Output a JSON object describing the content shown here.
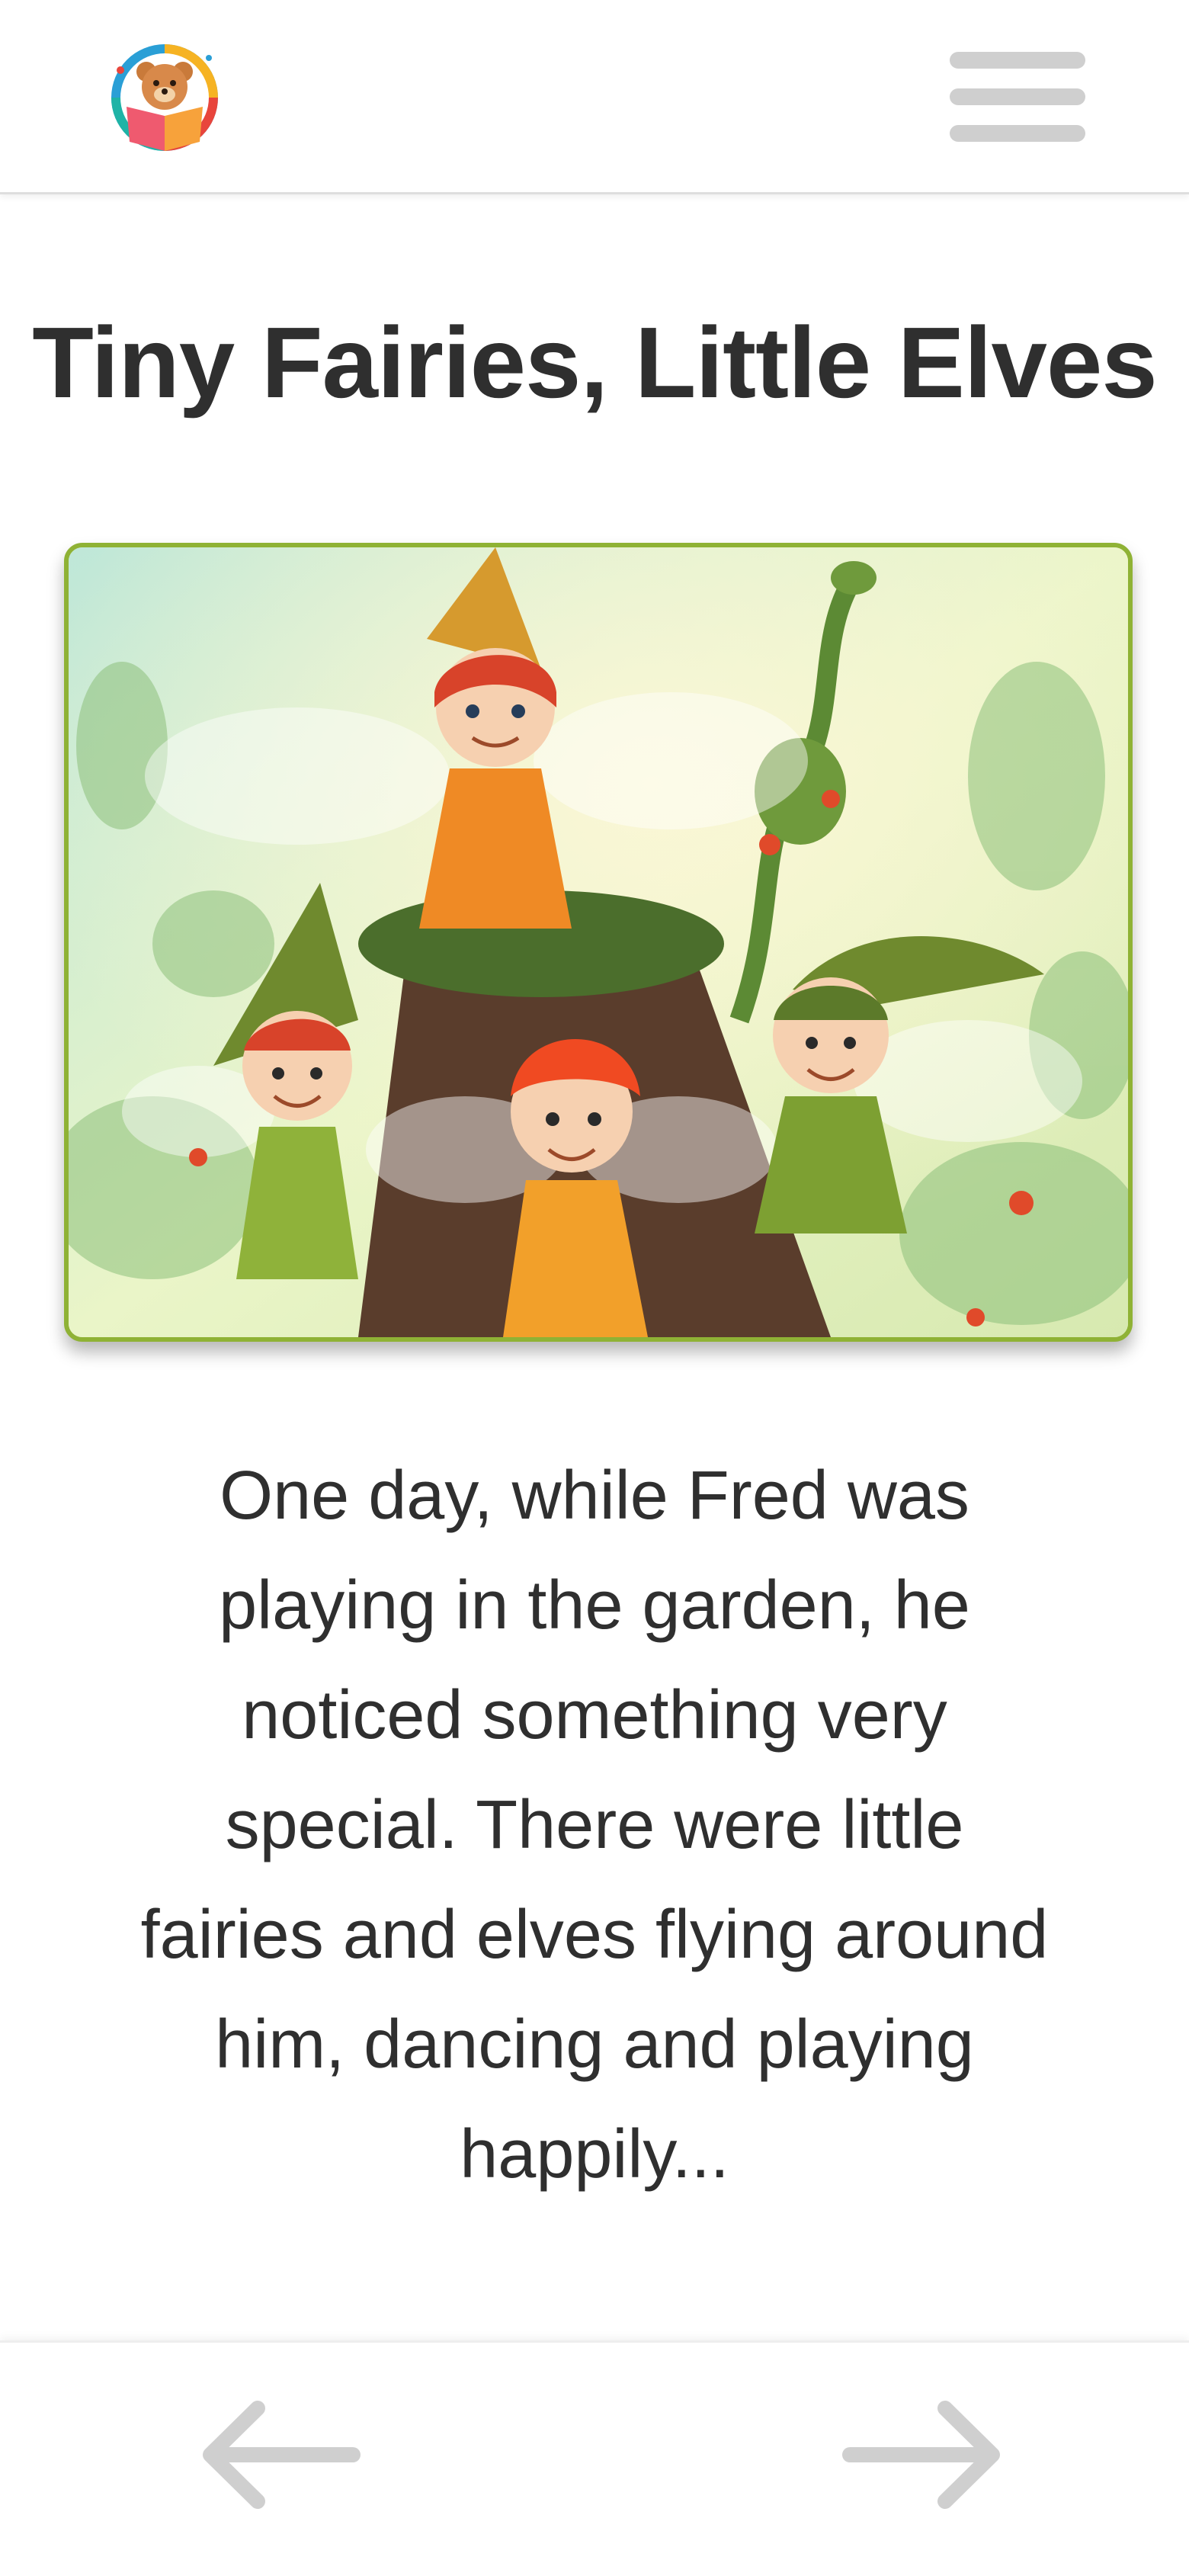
{
  "header": {
    "logo_icon": "teddy-bear-reading-book-icon",
    "menu_icon": "hamburger-menu-icon"
  },
  "page": {
    "title": "Tiny Fairies, Little Elves",
    "story_text": "One day, while Fred was playing in the garden, he noticed something very special. There were little fairies and elves flying around him, dancing and playing happily..."
  },
  "illustration": {
    "subject": "fairies-and-elves-on-tree-stump-illustration",
    "border_color": "#8fb235"
  },
  "footer": {
    "prev_icon": "arrow-left-icon",
    "next_icon": "arrow-right-icon",
    "arrow_color": "#cfcfcf"
  }
}
